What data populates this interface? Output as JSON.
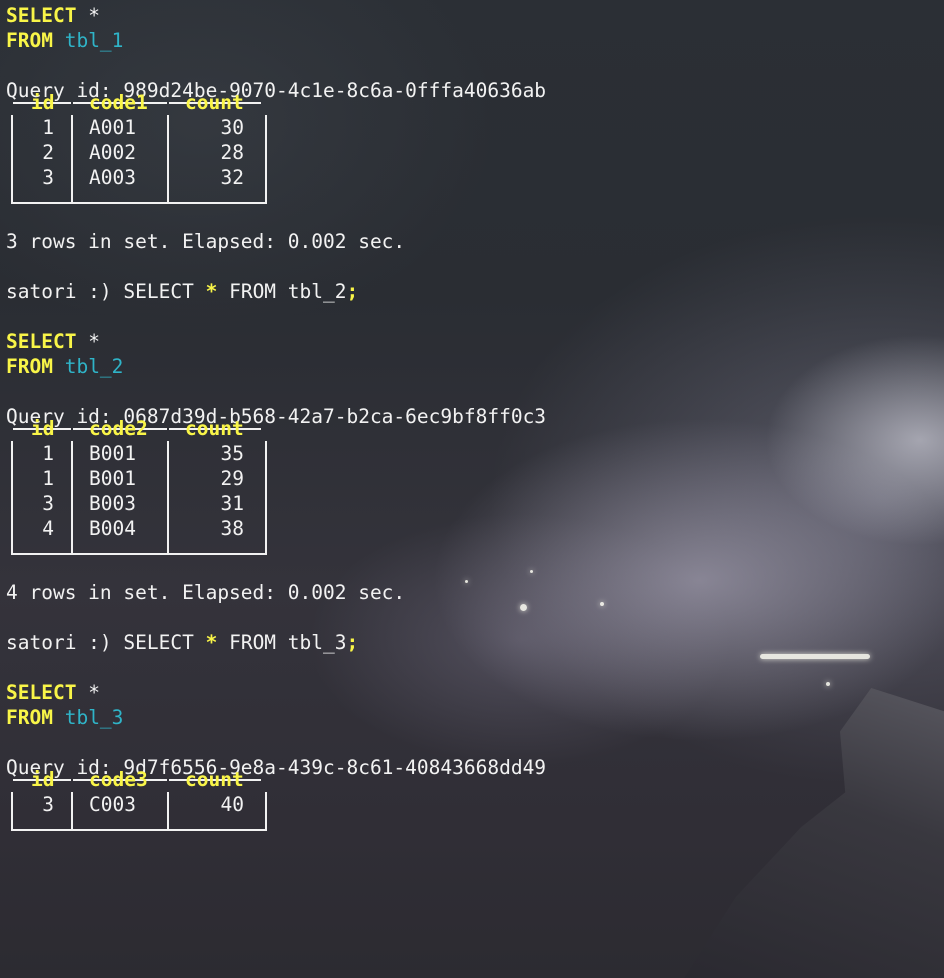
{
  "blocks": [
    {
      "select_kw": "SELECT",
      "star": "*",
      "from_kw": "FROM",
      "table": "tbl_1",
      "query_id_label": "Query id:",
      "query_id": "989d24be-9070-4c1e-8c6a-0fffa40636ab",
      "headers": [
        "id",
        "code1",
        "count"
      ],
      "rows": [
        [
          "1",
          "A001",
          "30"
        ],
        [
          "2",
          "A002",
          "28"
        ],
        [
          "3",
          "A003",
          "32"
        ]
      ],
      "summary": "3 rows in set. Elapsed: 0.002 sec.",
      "next_prompt": "satori :) ",
      "next_cmd_a": "SELECT ",
      "next_cmd_star": "*",
      "next_cmd_b": " FROM tbl_2",
      "next_cmd_semi": ";"
    },
    {
      "select_kw": "SELECT",
      "star": "*",
      "from_kw": "FROM",
      "table": "tbl_2",
      "query_id_label": "Query id:",
      "query_id": "0687d39d-b568-42a7-b2ca-6ec9bf8ff0c3",
      "headers": [
        "id",
        "code2",
        "count"
      ],
      "rows": [
        [
          "1",
          "B001",
          "35"
        ],
        [
          "1",
          "B001",
          "29"
        ],
        [
          "3",
          "B003",
          "31"
        ],
        [
          "4",
          "B004",
          "38"
        ]
      ],
      "summary": "4 rows in set. Elapsed: 0.002 sec.",
      "next_prompt": "satori :) ",
      "next_cmd_a": "SELECT ",
      "next_cmd_star": "*",
      "next_cmd_b": " FROM tbl_3",
      "next_cmd_semi": ";"
    },
    {
      "select_kw": "SELECT",
      "star": "*",
      "from_kw": "FROM",
      "table": "tbl_3",
      "query_id_label": "Query id:",
      "query_id": "9d7f6556-9e8a-439c-8c61-40843668dd49",
      "headers": [
        "id",
        "code3",
        "count"
      ],
      "rows": [
        [
          "3",
          "C003",
          "40"
        ]
      ]
    }
  ]
}
